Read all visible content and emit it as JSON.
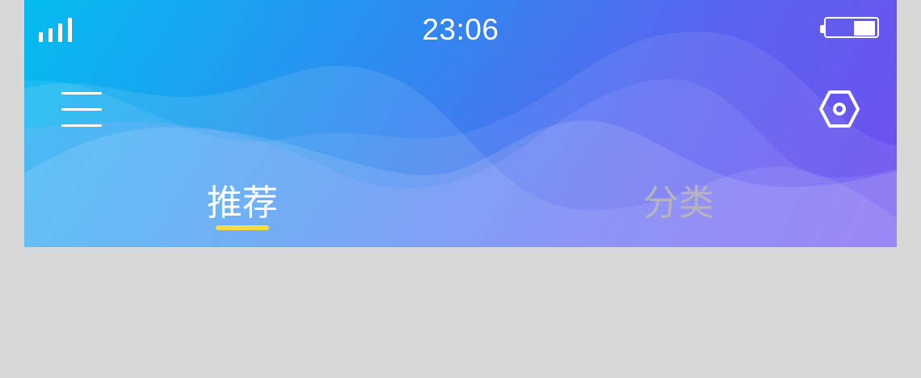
{
  "status_bar": {
    "time": "23:06",
    "signal_bars": 4,
    "battery_level": 0.45,
    "signal_icon": "signal-bars-icon",
    "battery_icon": "battery-icon"
  },
  "toolbar": {
    "menu_icon": "hamburger-menu-icon",
    "settings_icon": "hexagon-settings-icon"
  },
  "tabs": [
    {
      "label": "推荐",
      "active": true
    },
    {
      "label": "分类",
      "active": false
    }
  ],
  "colors": {
    "header_gradient_start": "#03bdf0",
    "header_gradient_end": "#6f4ef0",
    "active_tab_text": "#ffffff",
    "inactive_tab_text": "#b6b3bf",
    "active_indicator": "#f8dd3f",
    "page_background": "#d8d8d8"
  }
}
